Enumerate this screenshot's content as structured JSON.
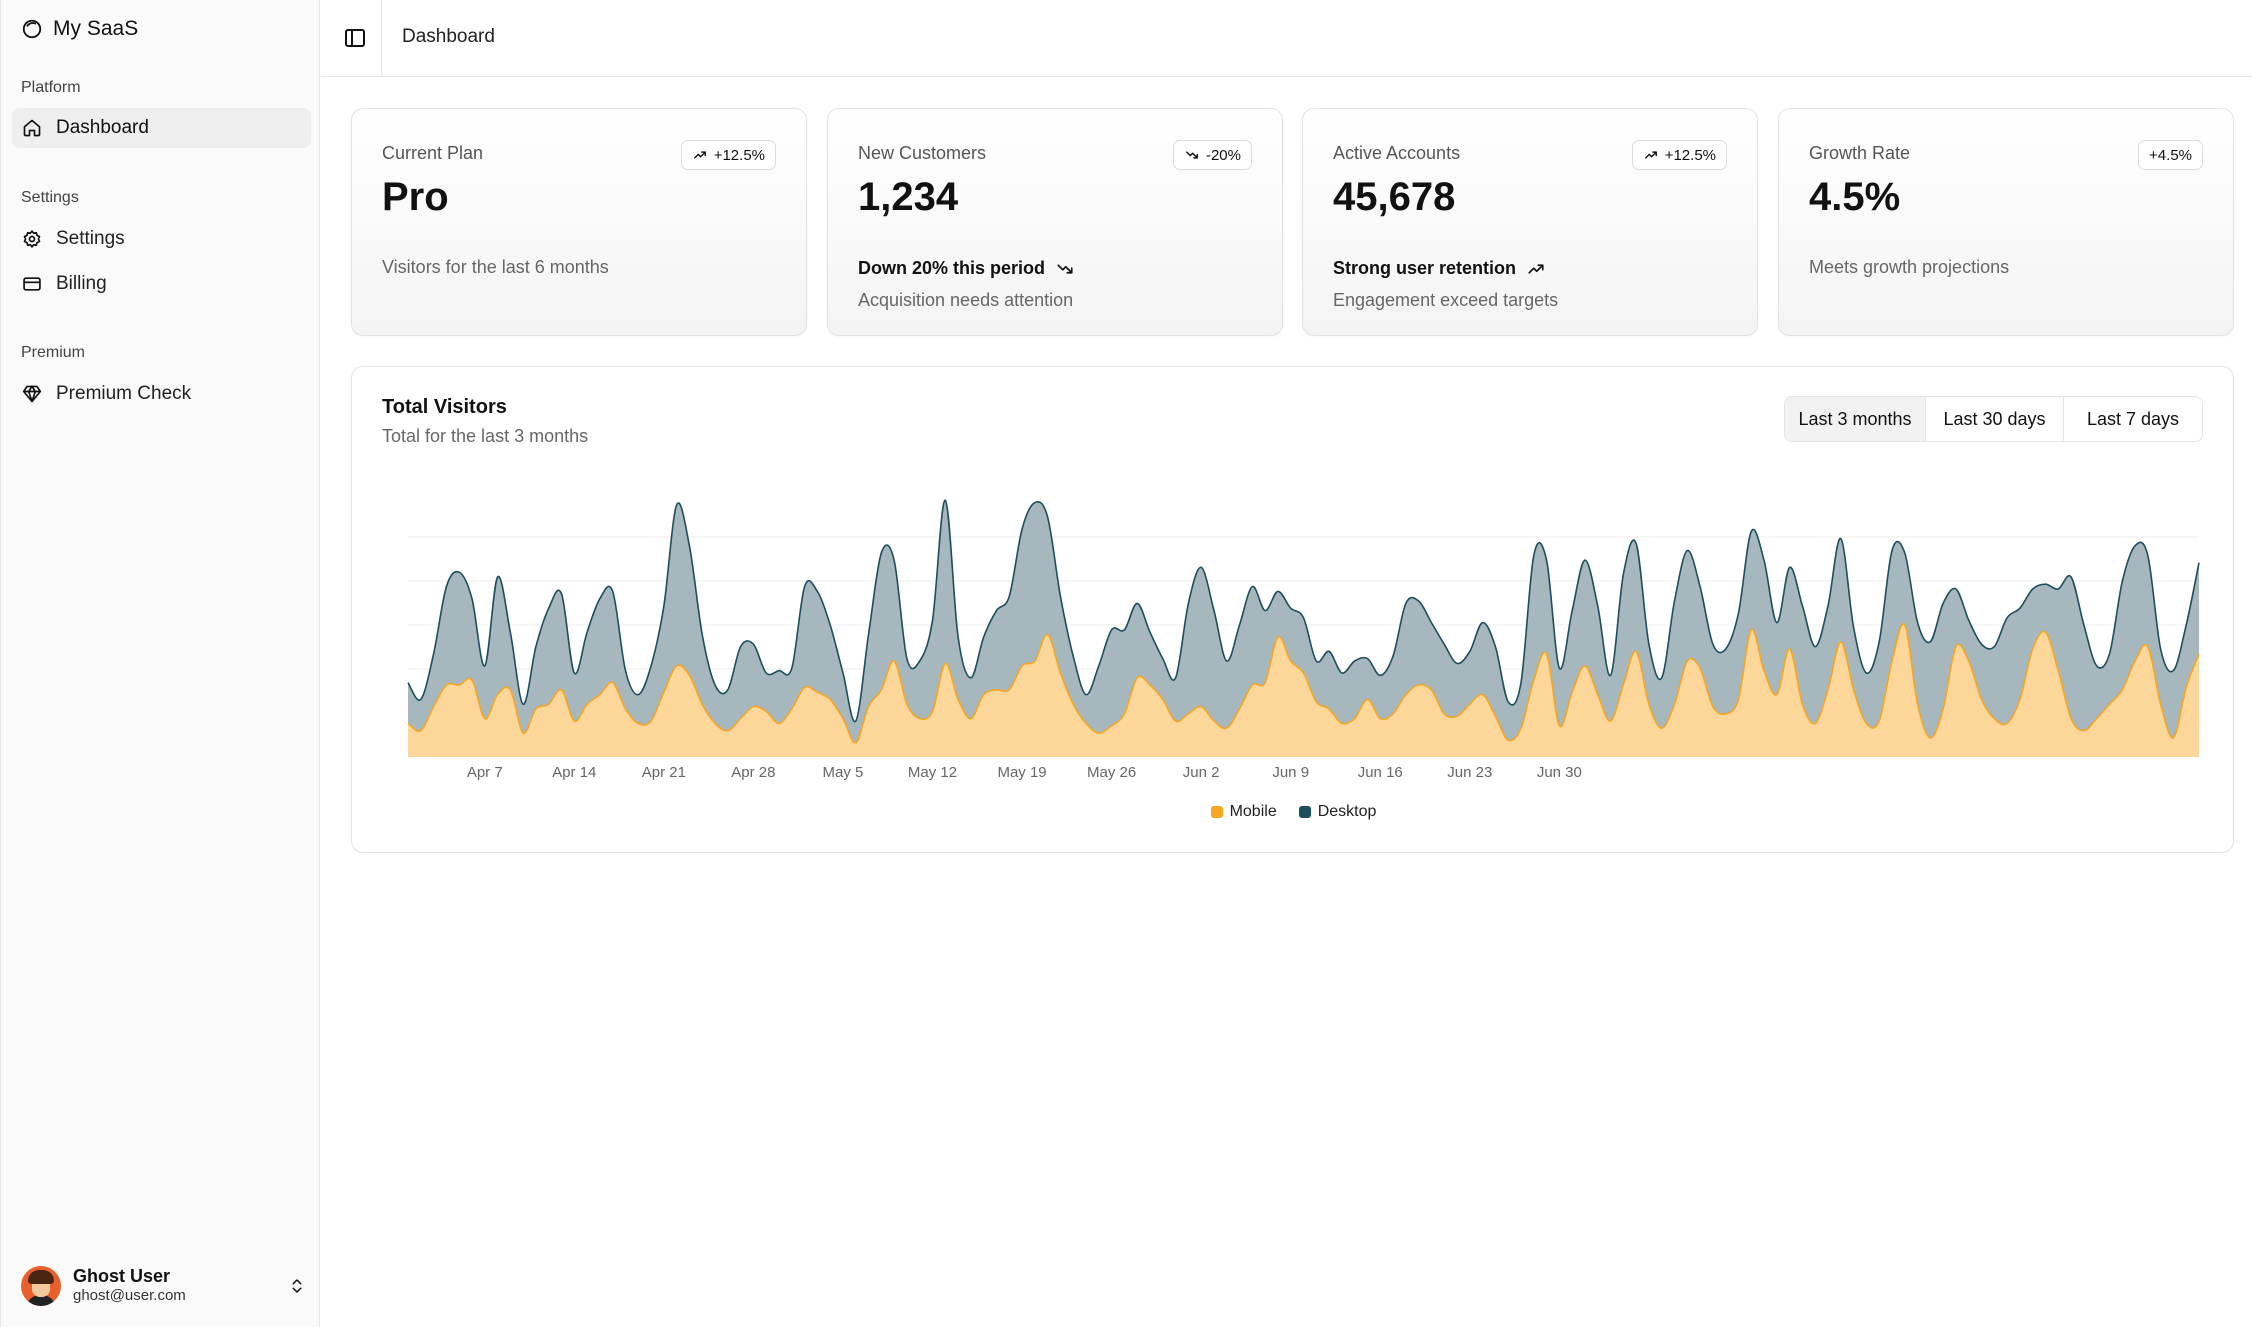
{
  "app": {
    "name": "My SaaS"
  },
  "sidebar": {
    "groups": [
      {
        "label": "Platform",
        "items": [
          {
            "label": "Dashboard",
            "icon": "home-icon",
            "active": true
          }
        ]
      },
      {
        "label": "Settings",
        "items": [
          {
            "label": "Settings",
            "icon": "gear-icon"
          },
          {
            "label": "Billing",
            "icon": "credit-card-icon"
          }
        ]
      },
      {
        "label": "Premium",
        "items": [
          {
            "label": "Premium Check",
            "icon": "gem-icon"
          }
        ]
      }
    ],
    "user": {
      "name": "Ghost User",
      "email": "ghost@user.com"
    }
  },
  "header": {
    "title": "Dashboard"
  },
  "cards": [
    {
      "label": "Current Plan",
      "badge": "+12.5%",
      "badge_icon": "trending-up-icon",
      "value": "Pro",
      "trend": "",
      "description": "Visitors for the last 6 months"
    },
    {
      "label": "New Customers",
      "badge": "-20%",
      "badge_icon": "trending-down-icon",
      "value": "1,234",
      "trend": "Down 20% this period",
      "trend_icon": "trending-down-icon",
      "description": "Acquisition needs attention"
    },
    {
      "label": "Active Accounts",
      "badge": "+12.5%",
      "badge_icon": "trending-up-icon",
      "value": "45,678",
      "trend": "Strong user retention",
      "trend_icon": "trending-up-icon",
      "description": "Engagement exceed targets"
    },
    {
      "label": "Growth Rate",
      "badge": "+4.5%",
      "value": "4.5%",
      "trend": "",
      "description": "Meets growth projections"
    }
  ],
  "chart": {
    "title": "Total Visitors",
    "subtitle": "Total for the last 3 months",
    "ranges": [
      {
        "label": "Last 3 months",
        "active": true
      },
      {
        "label": "Last 30 days"
      },
      {
        "label": "Last 7 days"
      }
    ],
    "colors": {
      "mobile": "#f5a623",
      "mobile_fill": "#fdd79a",
      "desktop": "#1e4d5c",
      "desktop_fill": "#a6b7bd"
    }
  },
  "chart_data": {
    "type": "area",
    "stacked": true,
    "x_start": "Apr 1",
    "x_end": "Jun 30",
    "tick_labels": [
      "Apr 7",
      "Apr 14",
      "Apr 21",
      "Apr 28",
      "May 5",
      "May 12",
      "May 19",
      "May 26",
      "Jun 2",
      "Jun 9",
      "Jun 16",
      "Jun 23",
      "Jun 30"
    ],
    "grid": "horizontal",
    "ylim": [
      0,
      500
    ],
    "series": [
      {
        "name": "Mobile",
        "values": [
          70,
          55,
          105,
          150,
          150,
          160,
          80,
          130,
          140,
          50,
          100,
          110,
          140,
          75,
          110,
          130,
          155,
          100,
          70,
          75,
          135,
          190,
          170,
          110,
          70,
          55,
          80,
          105,
          95,
          70,
          100,
          145,
          135,
          120,
          80,
          30,
          105,
          140,
          200,
          110,
          80,
          95,
          195,
          120,
          80,
          130,
          140,
          140,
          190,
          200,
          255,
          175,
          110,
          70,
          50,
          65,
          90,
          165,
          150,
          120,
          75,
          90,
          105,
          75,
          60,
          100,
          150,
          155,
          250,
          200,
          175,
          115,
          100,
          70,
          80,
          120,
          80,
          90,
          130,
          150,
          140,
          90,
          85,
          110,
          130,
          85,
          35,
          60,
          160,
          215,
          65,
          135,
          190,
          130,
          75,
          150,
          220,
          110,
          60,
          110,
          200,
          185,
          105,
          90,
          120,
          265,
          180,
          130,
          225,
          110,
          70,
          140,
          240,
          140,
          70,
          75,
          200,
          275,
          110,
          40,
          100,
          230,
          200,
          120,
          80,
          70,
          120,
          225,
          260,
          180,
          80,
          55,
          80,
          110,
          140,
          200,
          230,
          110,
          40,
          145,
          215
        ]
      },
      {
        "name": "Desktop",
        "values": [
          85,
          65,
          110,
          205,
          235,
          170,
          110,
          245,
          120,
          60,
          130,
          200,
          200,
          100,
          150,
          200,
          190,
          80,
          60,
          115,
          180,
          335,
          270,
          145,
          80,
          85,
          150,
          130,
          80,
          110,
          85,
          210,
          210,
          155,
          95,
          45,
          150,
          285,
          210,
          95,
          120,
          190,
          340,
          130,
          85,
          120,
          165,
          195,
          285,
          330,
          245,
          160,
          100,
          60,
          140,
          200,
          175,
          155,
          110,
          85,
          90,
          230,
          290,
          230,
          140,
          175,
          205,
          150,
          95,
          110,
          115,
          85,
          120,
          105,
          120,
          85,
          90,
          120,
          190,
          175,
          140,
          145,
          110,
          110,
          150,
          145,
          80,
          95,
          260,
          195,
          120,
          170,
          220,
          185,
          95,
          230,
          225,
          125,
          105,
          215,
          230,
          170,
          130,
          135,
          180,
          205,
          230,
          150,
          170,
          205,
          160,
          175,
          215,
          130,
          105,
          165,
          230,
          150,
          170,
          200,
          220,
          120,
          85,
          115,
          150,
          220,
          190,
          125,
          100,
          170,
          295,
          220,
          110,
          105,
          225,
          240,
          190,
          115,
          140,
          130,
          190
        ]
      }
    ]
  }
}
